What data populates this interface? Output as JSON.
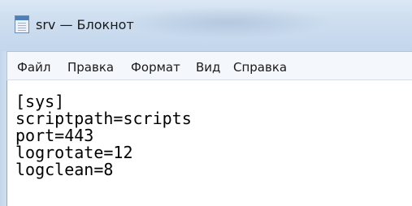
{
  "window": {
    "title": "srv — Блокнот"
  },
  "menu": {
    "items": [
      "Файл",
      "Правка",
      "Формат",
      "Вид",
      "Справка"
    ]
  },
  "editor": {
    "lines": [
      "[sys]",
      "scriptpath=scripts",
      "port=443",
      "logrotate=12",
      "logclean=8"
    ]
  },
  "icons": {
    "app_icon": "notepad-icon"
  }
}
